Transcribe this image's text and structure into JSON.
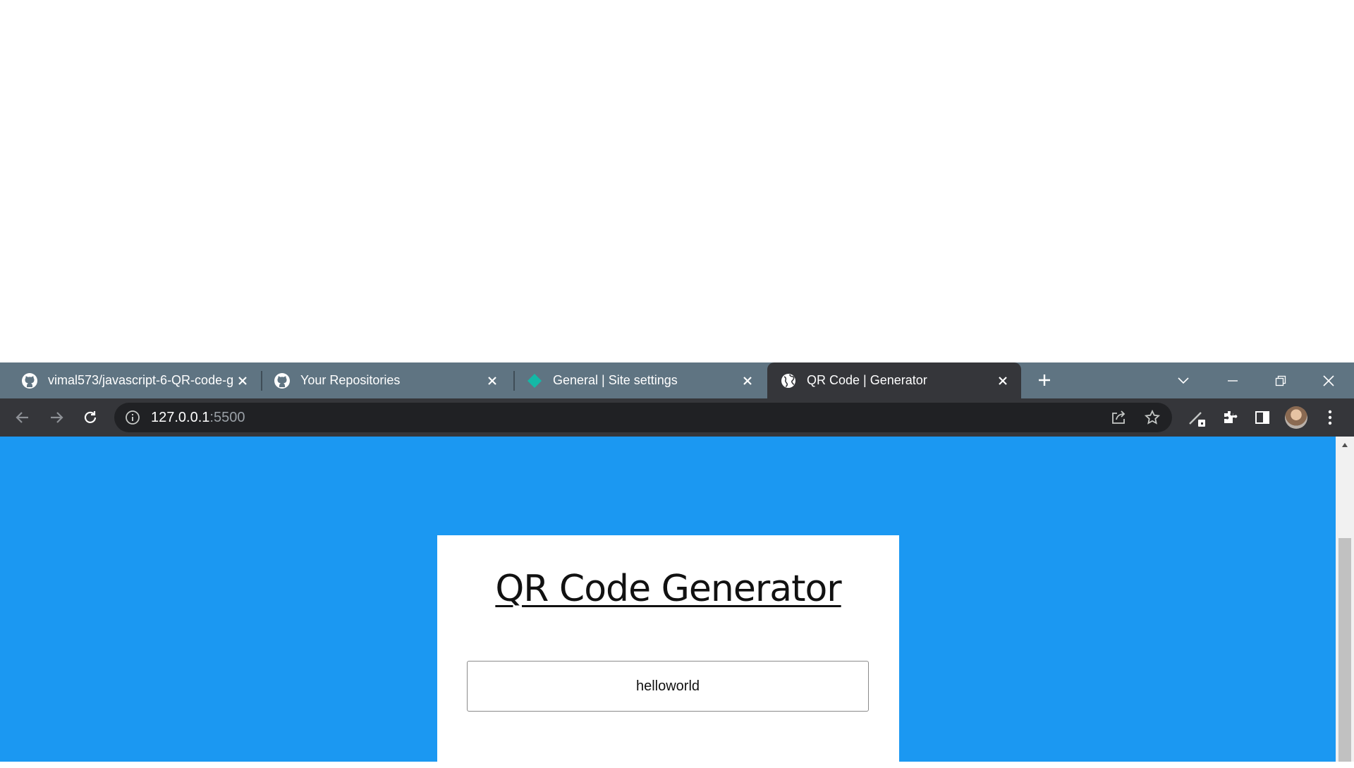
{
  "browser": {
    "tabs": [
      {
        "title": "vimal573/javascript-6-QR-code-g",
        "favicon": "github-icon",
        "active": false
      },
      {
        "title": "Your Repositories",
        "favicon": "github-icon",
        "active": false
      },
      {
        "title": "General | Site settings",
        "favicon": "diamond-icon",
        "active": false
      },
      {
        "title": "QR Code | Generator",
        "favicon": "globe-icon",
        "active": true
      }
    ],
    "url": {
      "host": "127.0.0.1",
      "port": ":5500"
    },
    "colors": {
      "tabstrip": "#5f7482",
      "toolbar": "#35363a",
      "omnibox": "#202124"
    }
  },
  "page": {
    "heading": "QR Code Generator",
    "input_value": "helloworld",
    "background": "#1b98f2"
  }
}
